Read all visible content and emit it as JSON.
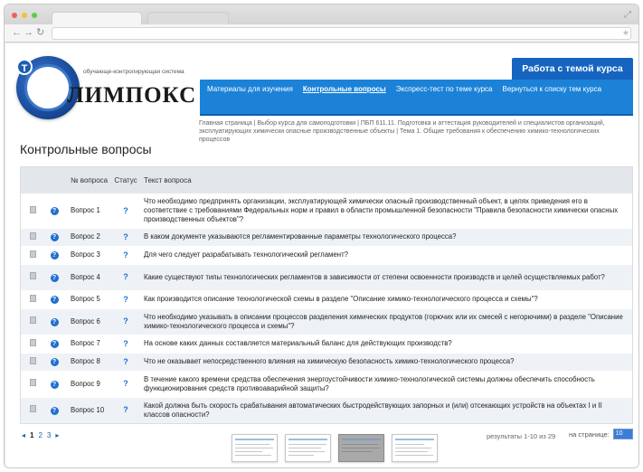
{
  "site": {
    "logo_tagline": "обучающе-контролирующая система",
    "logo_name": "ЛИМПОКС",
    "logo_badge": "Т"
  },
  "header": {
    "theme_tab": "Работа с темой курса",
    "nav": [
      {
        "label": "Материалы для изучения",
        "current": false
      },
      {
        "label": "Контрольные вопросы",
        "current": true
      },
      {
        "label": "Экспресс-тест по теме курса",
        "current": false
      },
      {
        "label": "Вернуться к списку тем курса",
        "current": false
      }
    ]
  },
  "breadcrumb": "Главная страница  |  Выбор курса для самоподготовки  |  ПБП 611.11. Подготовка и аттестация руководителей и специалистов организаций, эксплуатирующих химически опасные производственные объекты  |  Тема 1. Общие требования к обеспечению химико-технологических процессов",
  "page_title": "Контрольные вопросы",
  "table": {
    "headers": {
      "num": "№ вопроса",
      "status": "Статус",
      "text": "Текст вопроса"
    },
    "rows": [
      {
        "num": "Вопрос 1",
        "text": "Что необходимо предпринять организации, эксплуатирующей химически опасный производственный объект, в целях приведения его в соответствие с требованиями Федеральных норм и правил в области промышленной безопасности \"Правила безопасности химически опасных производственных объектов\"?"
      },
      {
        "num": "Вопрос 2",
        "text": "В каком документе указываются регламентированные параметры технологического процесса?"
      },
      {
        "num": "Вопрос 3",
        "text": "Для чего следует разрабатывать технологический регламент?"
      },
      {
        "num": "Вопрос 4",
        "text": "Какие существуют типы технологических регламентов в зависимости от степени освоенности производств и целей осуществляемых работ?"
      },
      {
        "num": "Вопрос 5",
        "text": "Как производится описание технологической схемы в разделе \"Описание химико-технологического процесса и схемы\"?"
      },
      {
        "num": "Вопрос 6",
        "text": "Что необходимо указывать в описании процессов разделения химических продуктов (горючих или их смесей с негорючими) в разделе \"Описание химико-технологического процесса и схемы\"?"
      },
      {
        "num": "Вопрос 7",
        "text": "На основе каких данных составляется материальный баланс для действующих производств?"
      },
      {
        "num": "Вопрос 8",
        "text": "Что не оказывает непосредственного влияния на химическую безопасность химико-технологического процесса?"
      },
      {
        "num": "Вопрос 9",
        "text": "В течение какого времени средства обеспечения энергоустойчивости химико-технологической системы должны обеспечить способность функционирования средств противоаварийной защиты?"
      },
      {
        "num": "Вопрос 10",
        "text": "Какой должна быть скорость срабатывания автоматических быстродействующих запорных и (или) отсекающих устройств на объектах I и II классов опасности?"
      }
    ]
  },
  "pagination": {
    "prev": "◂",
    "pages": [
      "1",
      "2",
      "3"
    ],
    "active_page": "1",
    "next": "▸",
    "results": "результаты 1-10 из 29",
    "per_page_label": "на странице:",
    "per_page_value": "10"
  },
  "colors": {
    "nav_blue": "#1b82d8",
    "tab_blue": "#1565c0",
    "icon_blue": "#1e6fd0"
  }
}
